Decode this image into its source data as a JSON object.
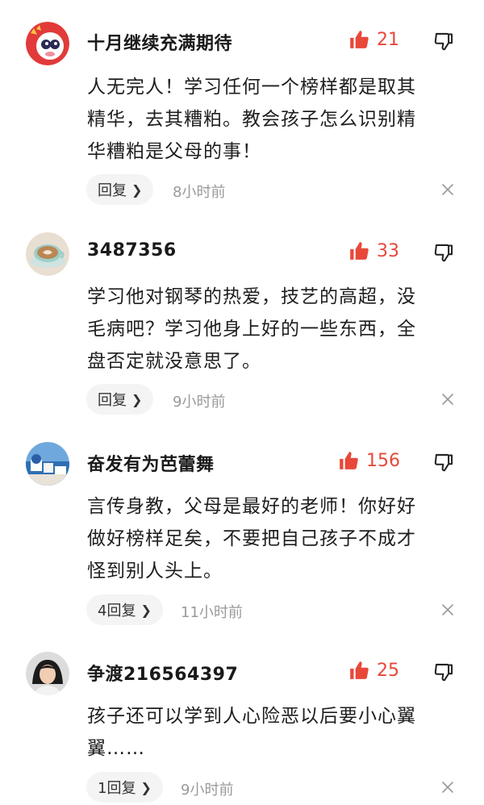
{
  "colors": {
    "accent_red": "#e8483a",
    "muted_gray": "#9a9a9a",
    "reply_bg": "#f4f4f4"
  },
  "comments": [
    {
      "username": "十月继续充满期待",
      "avatar_icon": "cartoon-character-avatar",
      "likes": "21",
      "text_lines": [
        "人无完人！学习任何一个榜样都是取其",
        "精华，去其糟粕。教会孩子怎么识别精",
        "华糟粕是父母的事！"
      ],
      "reply_label": "回复",
      "time": "8小时前"
    },
    {
      "username": "3487356",
      "avatar_icon": "coffee-cup-avatar",
      "likes": "33",
      "text_lines": [
        "学习他对钢琴的热爱，技艺的高超，没",
        "毛病吧？学习他身上好的一些东西，全",
        "盘否定就没意思了。"
      ],
      "reply_label": "回复",
      "time": "9小时前"
    },
    {
      "username": "奋发有为芭蕾舞",
      "avatar_icon": "seaside-town-avatar",
      "likes": "156",
      "text_lines": [
        "言传身教，父母是最好的老师！你好好",
        "做好榜样足矣，不要把自己孩子不成才",
        "怪到别人头上。"
      ],
      "reply_label": "4回复",
      "time": "11小时前"
    },
    {
      "username": "争渡216564397",
      "avatar_icon": "woman-portrait-avatar",
      "likes": "25",
      "text_lines": [
        "孩子还可以学到人心险恶以后要小心翼",
        "翼……"
      ],
      "reply_label": "1回复",
      "time": "9小时前"
    }
  ]
}
